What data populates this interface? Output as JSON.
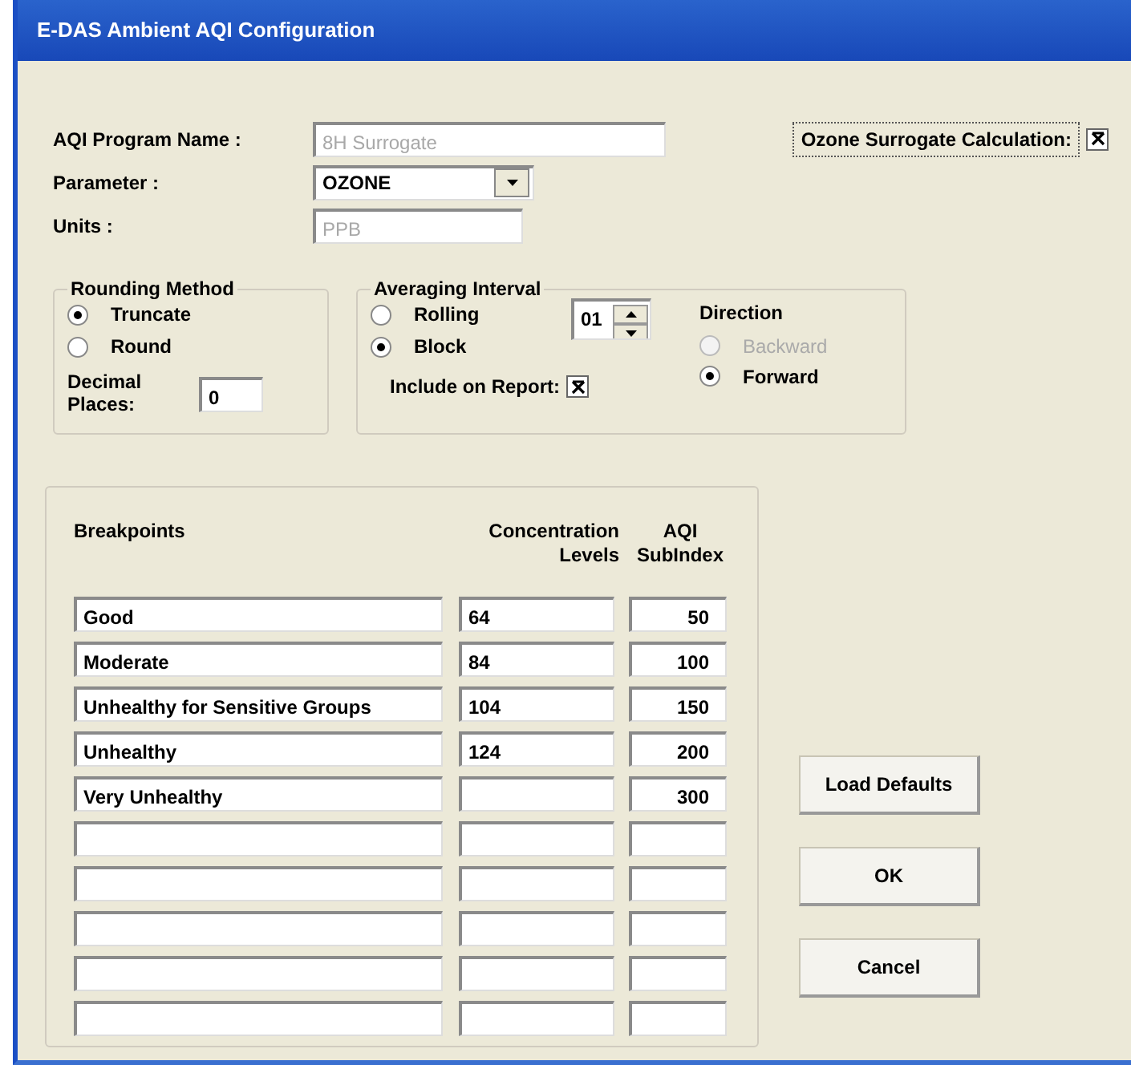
{
  "window": {
    "title": "E-DAS Ambient AQI Configuration"
  },
  "program_name": {
    "label": "AQI Program Name :",
    "value": "8H Surrogate",
    "disabled": true
  },
  "ozone_surrogate": {
    "label": "Ozone Surrogate Calculation:",
    "checked": true
  },
  "parameter": {
    "label": "Parameter :",
    "value": "OZONE",
    "disabled": false
  },
  "units": {
    "label": "Units :",
    "value": "PPB",
    "disabled": true
  },
  "rounding_method": {
    "title": "Rounding Method",
    "options": [
      {
        "label": "Truncate",
        "selected": true
      },
      {
        "label": "Round",
        "selected": false
      }
    ],
    "decimal_places": {
      "label": "Decimal Places:",
      "value": "0"
    }
  },
  "averaging_interval": {
    "title": "Averaging Interval",
    "options": [
      {
        "label": "Rolling",
        "selected": false
      },
      {
        "label": "Block",
        "selected": true
      }
    ],
    "interval": {
      "value": "01"
    },
    "include_on_report": {
      "label": "Include on Report:",
      "checked": true
    },
    "direction": {
      "title": "Direction",
      "options": [
        {
          "label": "Backward",
          "selected": false,
          "disabled": true
        },
        {
          "label": "Forward",
          "selected": true,
          "disabled": false
        }
      ]
    }
  },
  "breakpoints": {
    "columns": [
      "Breakpoints",
      "Concentration Levels",
      "AQI SubIndex"
    ],
    "rows": [
      {
        "kind": "filled",
        "breakpoint": "Good",
        "concentration": "64",
        "aqi": "50"
      },
      {
        "kind": "filled",
        "breakpoint": "Moderate",
        "concentration": "84",
        "aqi": "100"
      },
      {
        "kind": "filled",
        "breakpoint": "Unhealthy for Sensitive Groups",
        "concentration": "104",
        "aqi": "150"
      },
      {
        "kind": "filled",
        "breakpoint": "Unhealthy",
        "concentration": "124",
        "aqi": "200"
      },
      {
        "kind": "filled",
        "breakpoint": "Very Unhealthy",
        "aqi": "300"
      },
      {
        "kind": "blank"
      },
      {
        "kind": "blank"
      },
      {
        "kind": "blank"
      },
      {
        "kind": "blank"
      },
      {
        "kind": "blank"
      }
    ]
  },
  "buttons": [
    {
      "label": "Load Defaults"
    },
    {
      "label": "OK"
    },
    {
      "label": "Cancel"
    }
  ]
}
